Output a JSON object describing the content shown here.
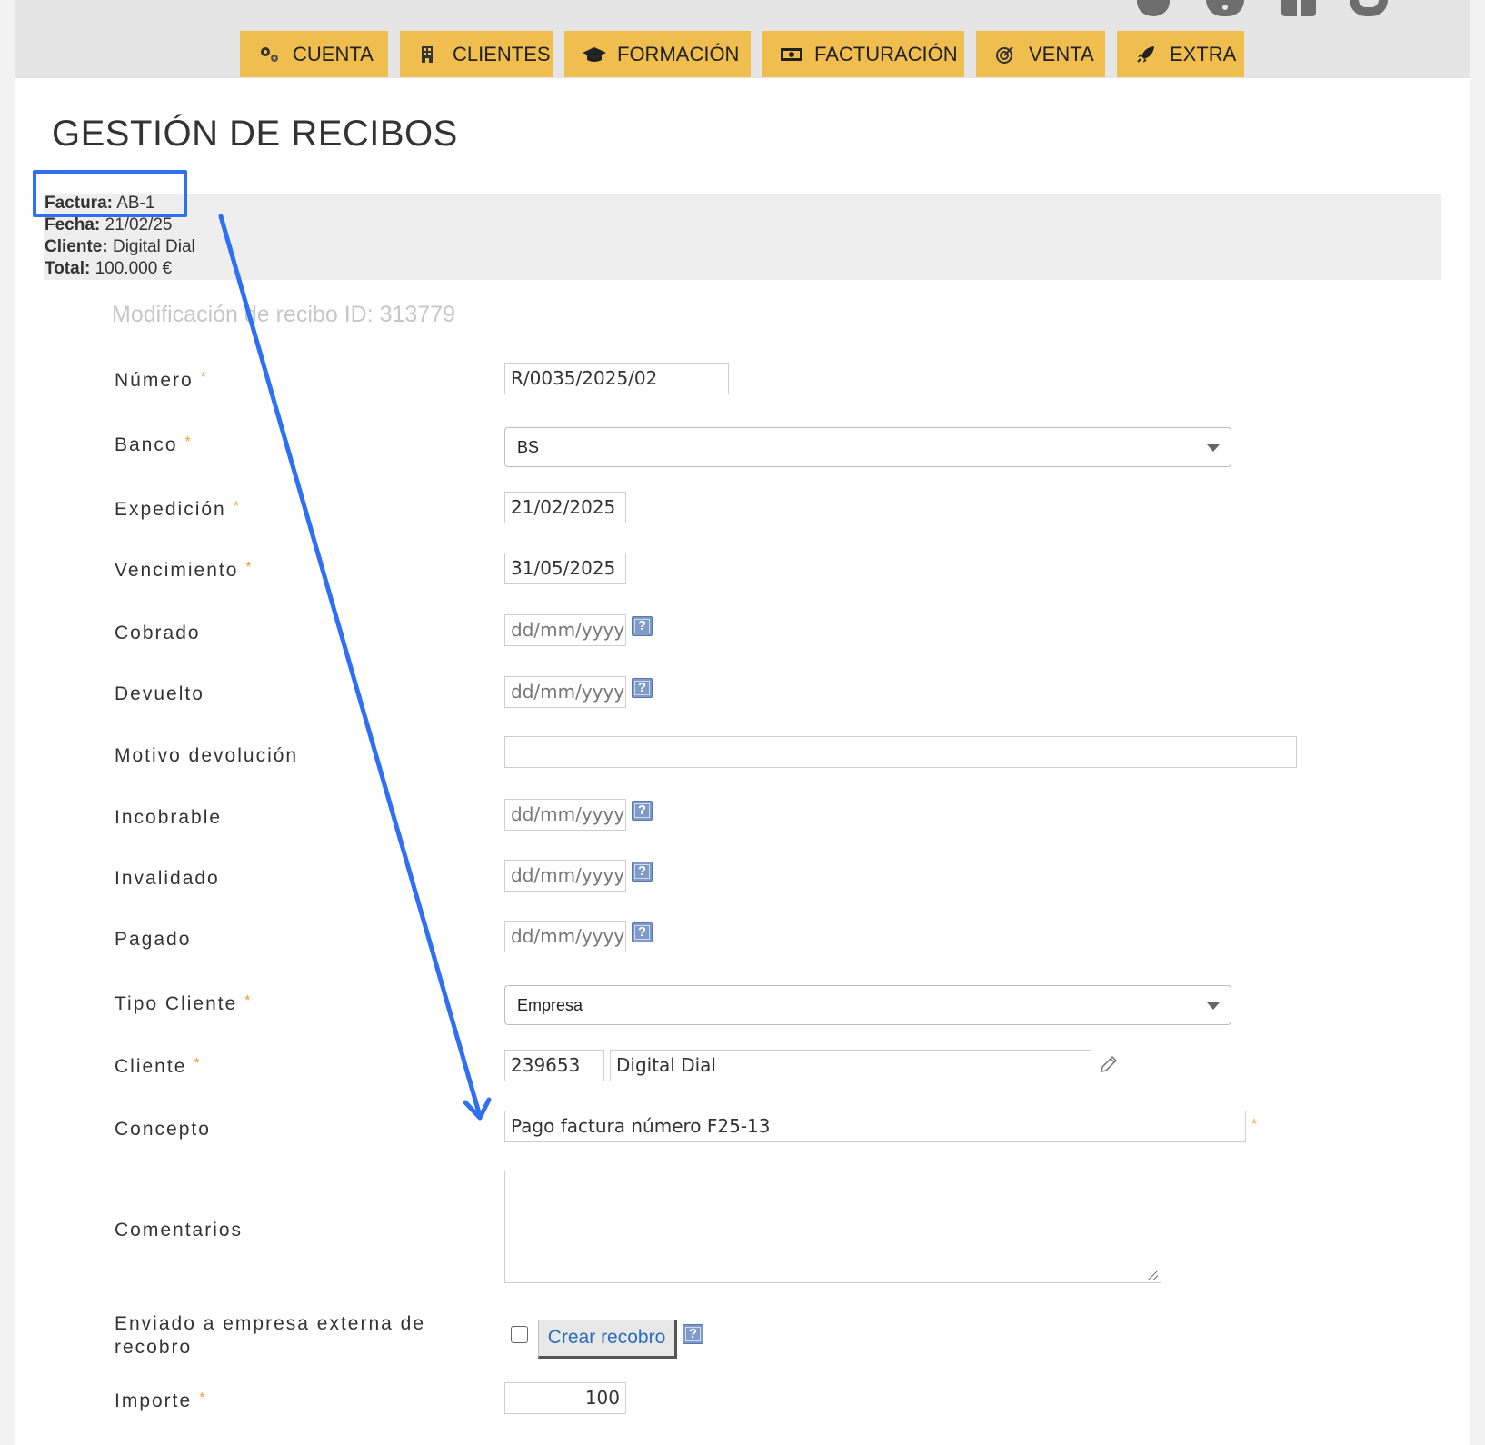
{
  "nav": {
    "items": [
      {
        "label": "CUENTA",
        "icon": "gears-icon"
      },
      {
        "label": "CLIENTES",
        "icon": "building-icon"
      },
      {
        "label": "FORMACIÓN",
        "icon": "graduation-cap-icon"
      },
      {
        "label": "FACTURACIÓN",
        "icon": "money-bill-icon"
      },
      {
        "label": "VENTA",
        "icon": "target-icon"
      },
      {
        "label": "EXTRA",
        "icon": "rocket-icon"
      }
    ],
    "top_icons": [
      "bell-icon",
      "info-icon",
      "gift-icon",
      "user-icon"
    ]
  },
  "page_title": "GESTIÓN DE RECIBOS",
  "invoice_info": {
    "factura_label": "Factura:",
    "factura_value": "AB-1",
    "fecha_label": "Fecha:",
    "fecha_value": "21/02/25",
    "cliente_label": "Cliente:",
    "cliente_value": "Digital Dial",
    "total_label": "Total:",
    "total_value": "100.000 €"
  },
  "subtitle": "Modificación de recibo ID: 313779",
  "form": {
    "numero": {
      "label": "Número",
      "value": "R/0035/2025/02"
    },
    "banco": {
      "label": "Banco",
      "value": "BS"
    },
    "expedicion": {
      "label": "Expedición",
      "value": "21/02/2025"
    },
    "vencimiento": {
      "label": "Vencimiento",
      "value": "31/05/2025"
    },
    "cobrado": {
      "label": "Cobrado",
      "placeholder": "dd/mm/yyyy"
    },
    "devuelto": {
      "label": "Devuelto",
      "placeholder": "dd/mm/yyyy"
    },
    "motivo_devolucion": {
      "label": "Motivo devolución",
      "value": ""
    },
    "incobrable": {
      "label": "Incobrable",
      "placeholder": "dd/mm/yyyy"
    },
    "invalidado": {
      "label": "Invalidado",
      "placeholder": "dd/mm/yyyy"
    },
    "pagado": {
      "label": "Pagado",
      "placeholder": "dd/mm/yyyy"
    },
    "tipo_cliente": {
      "label": "Tipo Cliente",
      "value": "Empresa"
    },
    "cliente": {
      "label": "Cliente",
      "id": "239653",
      "name": "Digital Dial"
    },
    "concepto": {
      "label": "Concepto",
      "value": "Pago factura número F25-13"
    },
    "comentarios": {
      "label": "Comentarios",
      "value": ""
    },
    "enviado_recobro": {
      "label_line1": "Enviado a empresa externa de",
      "label_line2": "recobro",
      "checked": false,
      "button_label": "Crear recobro"
    },
    "importe": {
      "label": "Importe",
      "value": "100"
    },
    "required_mark": "*",
    "help_mark": "?"
  },
  "annotation": {
    "color": "#2f6ff2"
  },
  "colors": {
    "nav": "#f0bd4f",
    "required": "#f0a030",
    "accent": "#2f6ff2"
  }
}
